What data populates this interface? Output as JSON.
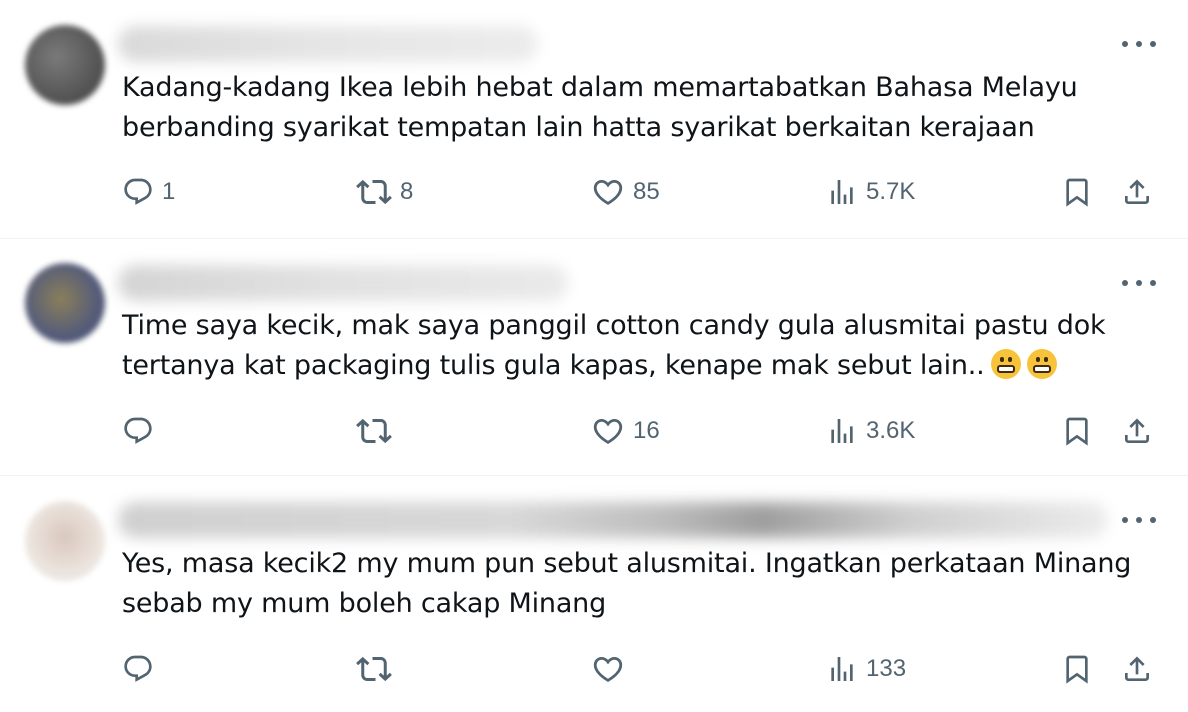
{
  "tweets": [
    {
      "text_lines": [
        "Kadang-kadang Ikea lebih hebat dalam memartabatkan Bahasa Melayu",
        "berbanding syarikat tempatan lain hatta syarikat berkaitan kerajaan"
      ],
      "replies": "1",
      "reposts": "8",
      "likes": "85",
      "views": "5.7K"
    },
    {
      "text_lines": [
        "Time saya kecik, mak saya panggil cotton candy gula alusmitai pastu dok",
        "tertanya kat packaging tulis gula kapas, kenape mak sebut lain.."
      ],
      "emojis": [
        "grimacing-face",
        "grimacing-face"
      ],
      "replies": "",
      "reposts": "",
      "likes": "16",
      "views": "3.6K"
    },
    {
      "text_lines": [
        "Yes, masa kecik2 my mum pun sebut alusmitai. Ingatkan perkataan Minang",
        "sebab my mum boleh cakap Minang"
      ],
      "replies": "",
      "reposts": "",
      "likes": "",
      "views": "133"
    }
  ],
  "icons": {
    "reply": "reply-icon",
    "repost": "repost-icon",
    "like": "like-icon",
    "views": "views-icon",
    "bookmark": "bookmark-icon",
    "share": "share-icon",
    "more": "more-icon"
  },
  "colors": {
    "text": "#0f1419",
    "secondary": "#536471",
    "divider": "#eff3f4"
  }
}
